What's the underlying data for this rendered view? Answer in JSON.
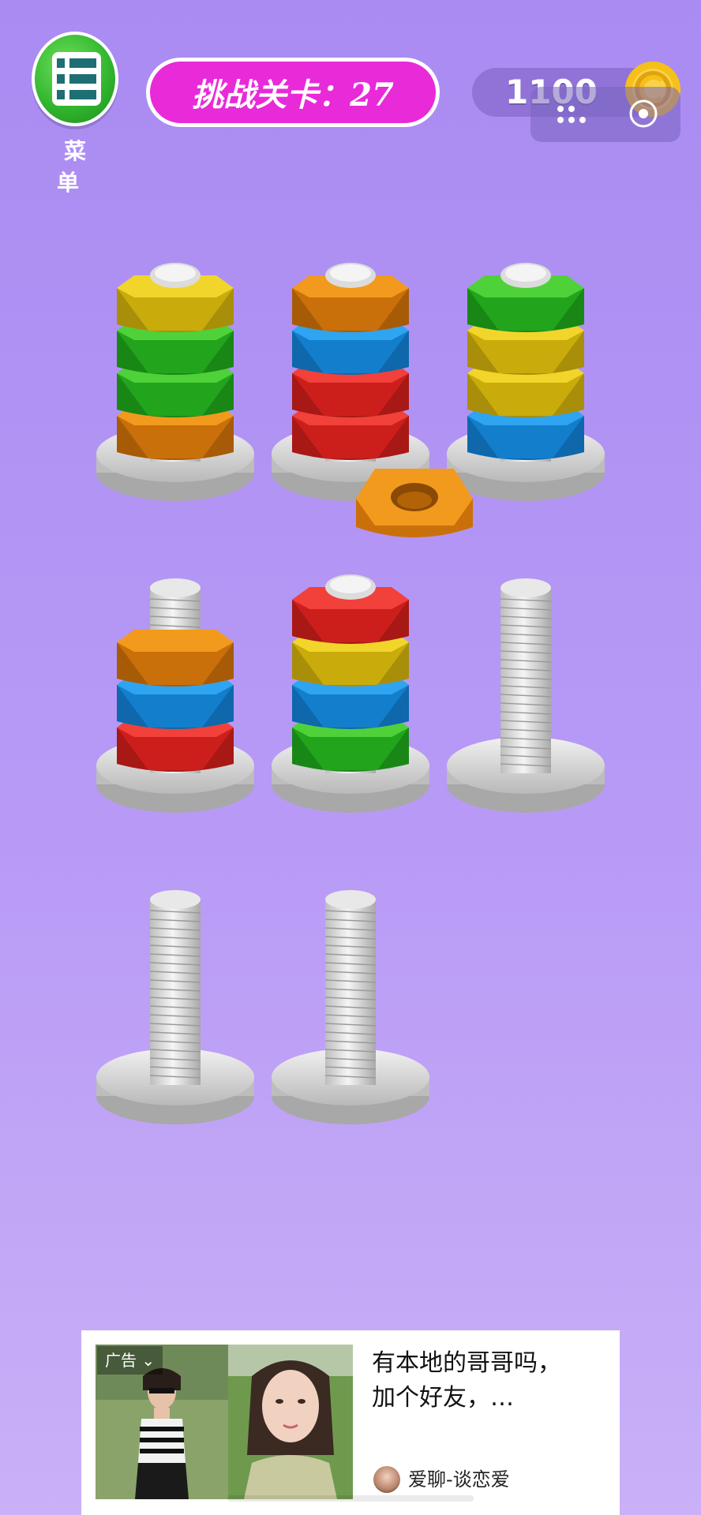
{
  "header": {
    "menu_label": "菜 单",
    "level_text": "挑战关卡：27",
    "coins": "1100"
  },
  "colors": {
    "background": "#b39af3",
    "menu_green": "#2fb32c",
    "level_pill": "#e82ad8",
    "coin_gold": "#f6c018"
  },
  "board": {
    "pegs": [
      {
        "id": "peg-1",
        "nuts_bottom_to_top": [
          "orange",
          "green",
          "green",
          "yellow"
        ]
      },
      {
        "id": "peg-2",
        "nuts_bottom_to_top": [
          "red",
          "red",
          "blue",
          "orange"
        ]
      },
      {
        "id": "peg-3",
        "nuts_bottom_to_top": [
          "blue",
          "yellow",
          "yellow",
          "green"
        ]
      },
      {
        "id": "peg-4",
        "nuts_bottom_to_top": [
          "red",
          "blue",
          "orange"
        ]
      },
      {
        "id": "peg-5",
        "nuts_bottom_to_top": [
          "green",
          "blue",
          "yellow",
          "red"
        ]
      },
      {
        "id": "peg-6",
        "nuts_bottom_to_top": []
      },
      {
        "id": "peg-7",
        "nuts_bottom_to_top": []
      },
      {
        "id": "peg-8",
        "nuts_bottom_to_top": []
      }
    ],
    "lifted_nut": "orange"
  },
  "ad": {
    "tag": "广告",
    "title_line1": "有本地的哥哥吗，",
    "title_line2": "加个好友，…",
    "brand": "爱聊-谈恋爱"
  }
}
